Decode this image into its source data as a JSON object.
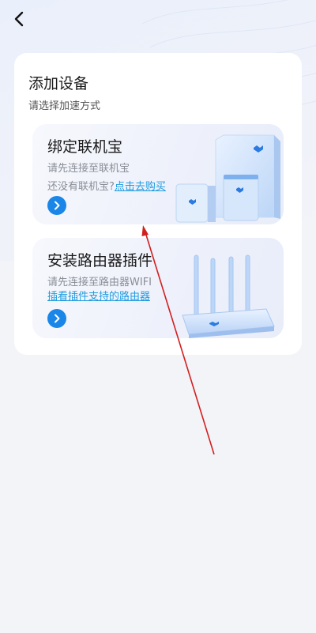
{
  "header": {
    "back_icon": "chevron-left-icon"
  },
  "panel": {
    "title": "添加设备",
    "subtitle": "请选择加速方式"
  },
  "cards": [
    {
      "title": "绑定联机宝",
      "line1": "请先连接至联机宝",
      "line2_prefix": "还没有联机宝?",
      "line2_link": "点击去购买",
      "go_icon": "chevron-right-icon"
    },
    {
      "title": "安装路由器插件",
      "line1": "请先连接至路由器WIFI",
      "link": "插看插件支持的路由器",
      "go_icon": "chevron-right-icon"
    }
  ],
  "colors": {
    "accent": "#1a86e8",
    "link": "#1e9be0",
    "annotation": "#d21f1f"
  }
}
